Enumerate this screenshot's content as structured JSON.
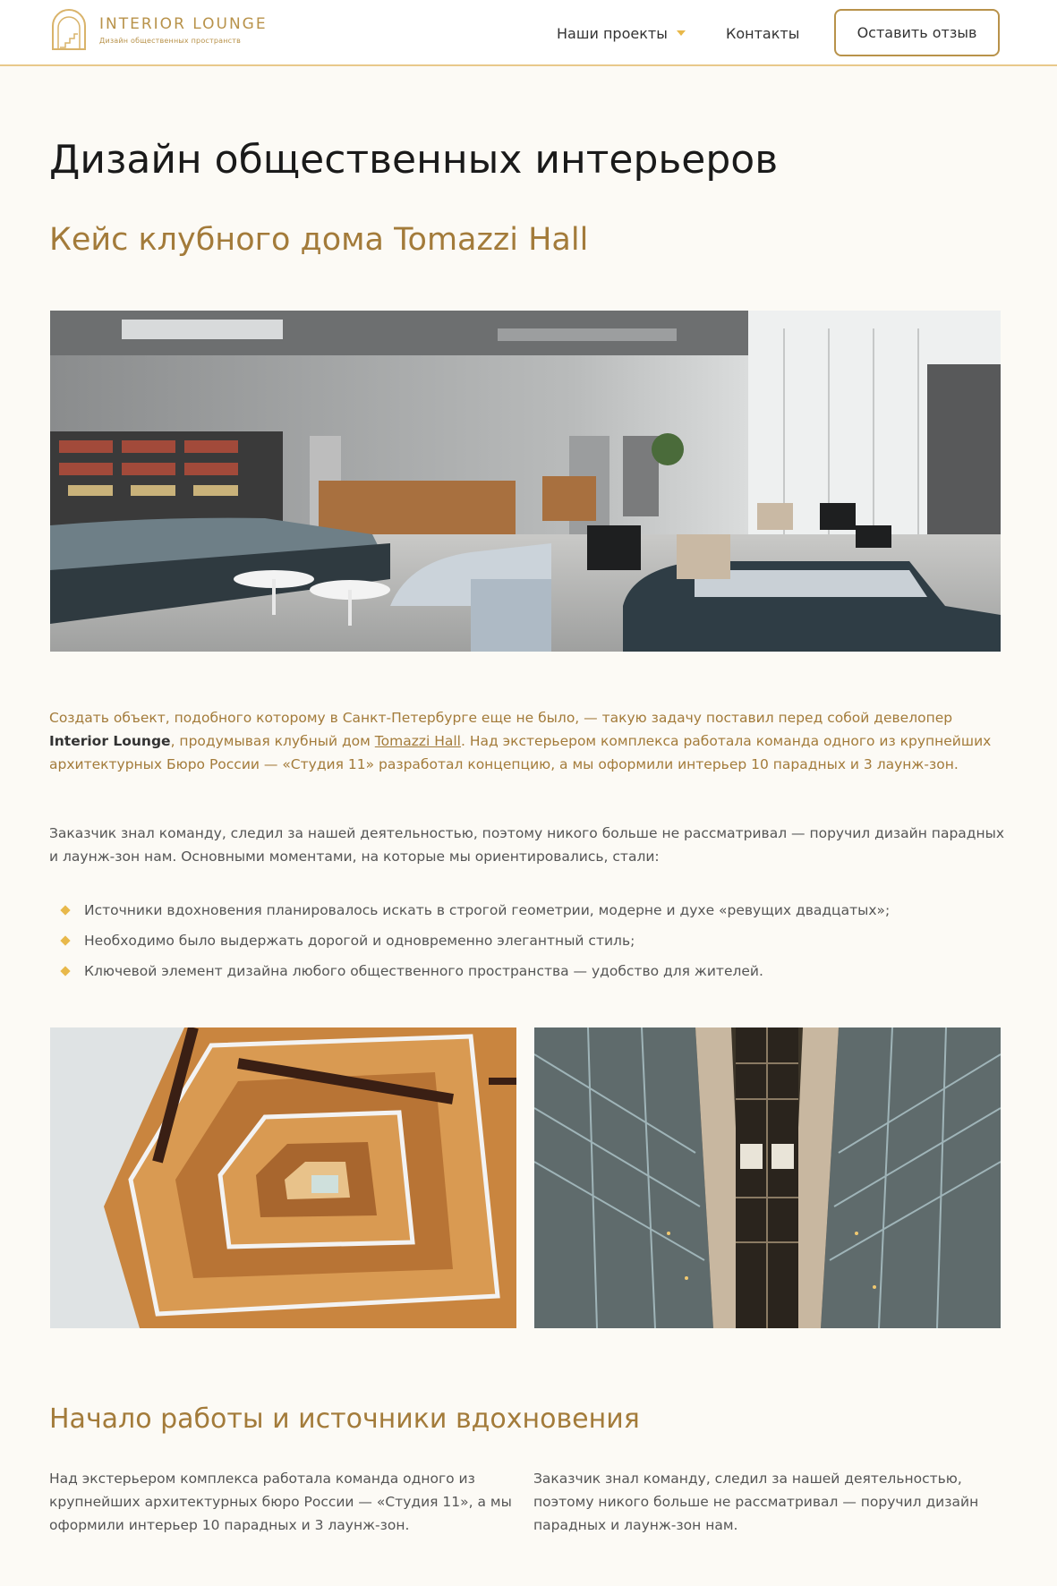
{
  "header": {
    "logo_title": "INTERIOR LOUNGE",
    "logo_subtitle": "Дизайн общественных пространств",
    "nav_projects": "Наши проекты",
    "nav_contacts": "Контакты",
    "review_button": "Оставить отзыв"
  },
  "main": {
    "title": "Дизайн общественных интерьеров",
    "subtitle": "Кейс клубного дома Tomazzi Hall",
    "intro": {
      "part1": "Создать объект, подобного которому в Санкт-Петербурге еще не было, — такую задачу поставил перед собой девелопер ",
      "brand": "Interior Lounge",
      "part2": ", продумывая клубный дом ",
      "link": "Tomazzi Hall",
      "part3": ". Над экстерьером комплекса работала команда одного из крупнейших архитектурных Бюро России — «Студия 11» разработал концепцию, а мы оформили интерьер 10 парадных и 3 лаунж-зон."
    },
    "paragraph2": "Заказчик знал команду, следил за нашей деятельностью, поэтому никого больше не рассматривал — поручил дизайн парадных и лаунж-зон нам. Основными моментами, на которые мы ориентировались, стали:",
    "bullets": [
      "Источники вдохновения планировалось искать в строгой геометрии, модерне и духе «ревущих двадцатых»;",
      "Необходимо было выдержать дорогой и одновременно элегантный стиль;",
      "Ключевой элемент дизайна любого общественного пространства — удобство для жителей."
    ],
    "section_title": "Начало работы и источники вдохновения",
    "col_left": "Над экстерьером комплекса работала команда одного из крупнейших архитектурных бюро России — «Студия 11», а мы оформили интерьер 10 парадных и 3 лаунж-зон.",
    "col_right": "Заказчик знал команду, следил за нашей деятельностью, поэтому никого больше не рассматривал — поручил дизайн парадных и лаунж-зон нам."
  },
  "colors": {
    "accent": "#a37b3a",
    "bullet": "#e8b84a",
    "background": "#fcfaf5"
  }
}
